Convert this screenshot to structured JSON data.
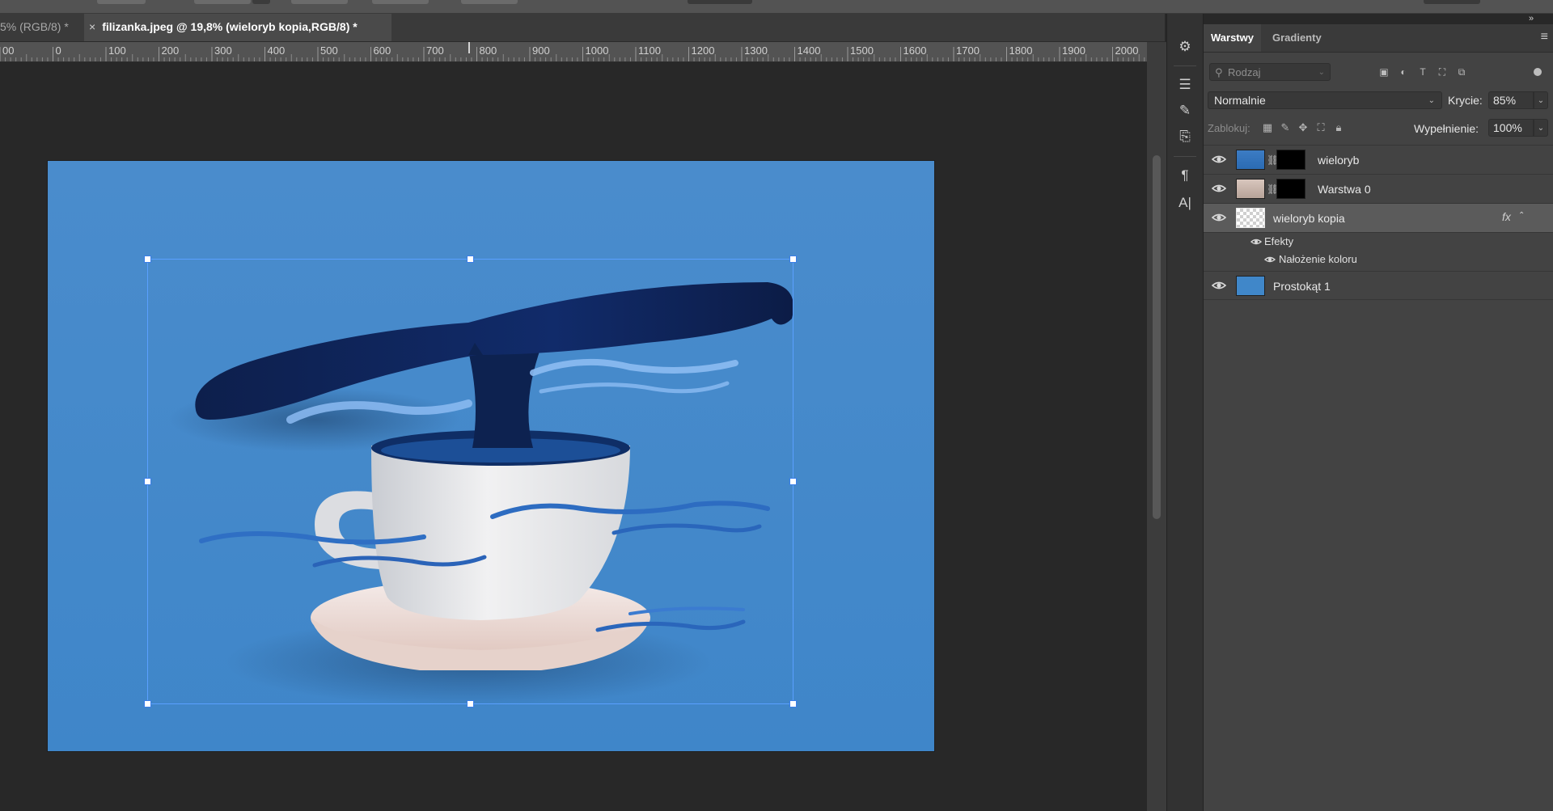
{
  "document_tabs": [
    {
      "label": "5% (RGB/8) *",
      "active": false
    },
    {
      "label": "filizanka.jpeg @ 19,8% (wieloryb kopia,RGB/8) *",
      "active": true,
      "close": "×"
    }
  ],
  "ruler": {
    "labels": [
      "00",
      "0",
      "100",
      "200",
      "300",
      "400",
      "500",
      "600",
      "700",
      "800",
      "900",
      "1000",
      "1100",
      "1200",
      "1300",
      "1400",
      "1500",
      "1600",
      "1700",
      "1800",
      "1900",
      "2000"
    ]
  },
  "tools": [
    {
      "icon": "adjustments-icon",
      "glyph": "⚙"
    },
    {
      "icon": "properties-icon",
      "glyph": "☰"
    },
    {
      "icon": "brush-icon",
      "glyph": "✎"
    },
    {
      "icon": "clone-source-icon",
      "glyph": "⎘"
    },
    {
      "icon": "paragraph-icon",
      "glyph": "¶"
    },
    {
      "icon": "character-icon",
      "glyph": "A|"
    }
  ],
  "panel": {
    "tabs": [
      "Warstwy",
      "Gradienty"
    ],
    "active_tab": "Warstwy",
    "menu_glyph": "≡",
    "filter": {
      "placeholder": "Rodzaj",
      "icons": [
        "image-filter-icon",
        "adjustment-filter-icon",
        "type-filter-icon",
        "shape-filter-icon",
        "smart-object-filter-icon"
      ]
    },
    "blend_mode": "Normalnie",
    "opacity_label": "Krycie:",
    "opacity_value": "85%",
    "lock_label": "Zablokuj:",
    "fill_label": "Wypełnienie:",
    "fill_value": "100%",
    "layers": [
      {
        "name": "wieloryb",
        "visible": true,
        "selected": false,
        "has_mask": true
      },
      {
        "name": "Warstwa 0",
        "visible": true,
        "selected": false,
        "has_mask": true
      },
      {
        "name": "wieloryb kopia",
        "visible": true,
        "selected": true,
        "has_fx": true,
        "fx_label": "fx"
      },
      {
        "name": "Prostokąt 1",
        "visible": true,
        "selected": false,
        "shape": true
      }
    ],
    "effects": {
      "group_label": "Efekty",
      "items": [
        "Nałożenie koloru"
      ]
    }
  },
  "colors": {
    "canvas_bg": "#4087c9",
    "selection": "#5aa0ff",
    "panel_bg": "#434343"
  }
}
